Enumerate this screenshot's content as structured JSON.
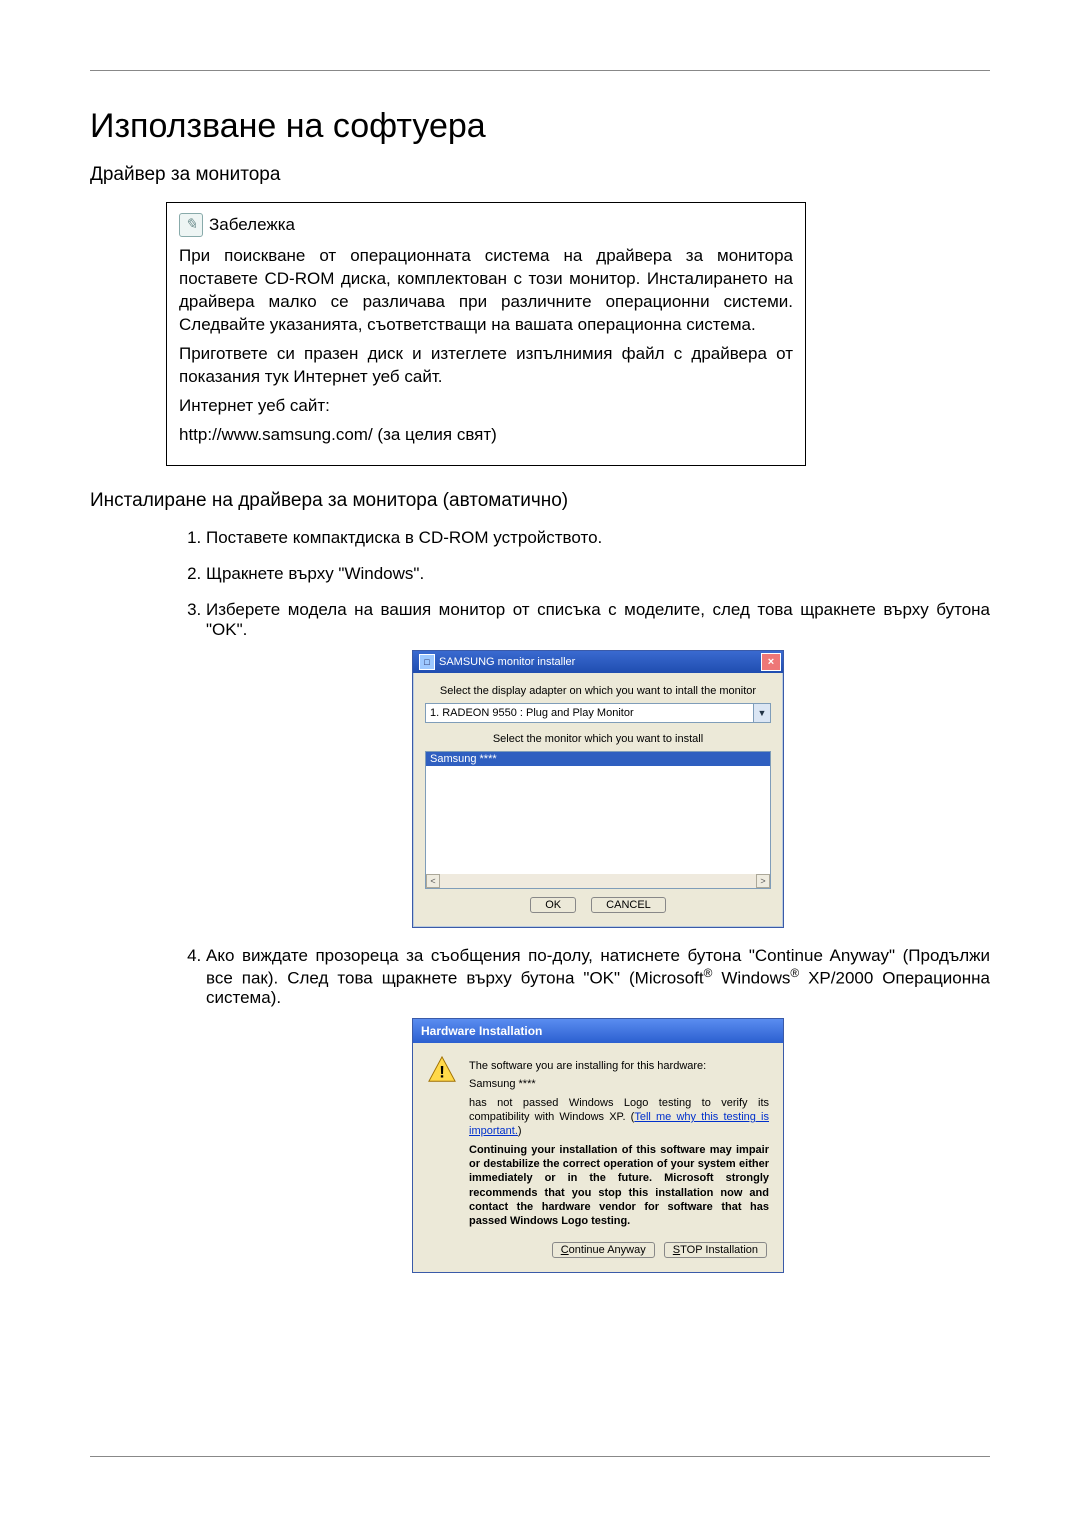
{
  "page": {
    "title": "Използване на софтуера",
    "section1": "Драйвер за монитора",
    "section2": "Инсталиране на драйвера за монитора (автоматично)"
  },
  "note": {
    "icon_glyph": "✎",
    "heading": "Забележка",
    "p1": "При поискване от операционната система на драйвера за монитора поставете CD-ROM диска, комплектован с този монитор. Инсталирането на драйвера малко се различава при различните операционни системи. Следвайте указанията, съответстващи на вашата операционна система.",
    "p2": "Пригответе си празен диск и изтеглете изпълнимия файл с драйвера от показания тук Интернет уеб сайт.",
    "site_label": "Интернет уеб сайт:",
    "site_value": "http://www.samsung.com/ (за целия свят)"
  },
  "steps": {
    "s1": "Поставете компактдиска в CD-ROM устройството.",
    "s2": "Щракнете върху \"Windows\".",
    "s3": "Изберете модела на вашия монитор от списъка с моделите, след това щракнете върху бутона \"OK\".",
    "s4_a": "Ако виждате прозореца за съобщения по-долу, натиснете бутона \"Continue Anyway\" (Продължи все пак). След това щракнете върху бутона \"OK\" (Microsoft",
    "s4_b": " Windows",
    "s4_c": " XP/2000 Операционна система).",
    "reg": "®"
  },
  "installer": {
    "title": "SAMSUNG monitor installer",
    "close": "×",
    "label_adapter": "Select the display adapter on which you want to intall the monitor",
    "combo_value": "1. RADEON 9550 : Plug and Play Monitor",
    "combo_arrow": "▼",
    "label_monitor": "Select the monitor which you want to install",
    "list_selected": "Samsung ****",
    "scroll_left": "<",
    "scroll_right": ">",
    "btn_ok": "OK",
    "btn_cancel": "CANCEL"
  },
  "hw": {
    "title": "Hardware Installation",
    "warn_glyph": "!",
    "line1": "The software you are installing for this hardware:",
    "line2": "Samsung ****",
    "line3a": "has not passed Windows Logo testing to verify its compatibility with Windows XP. (",
    "line3_link": "Tell me why this testing is important.",
    "line3b": ")",
    "bold": "Continuing your installation of this software may impair or destabilize the correct operation of your system either immediately or in the future. Microsoft strongly recommends that you stop this installation now and contact the hardware vendor for software that has passed Windows Logo testing.",
    "btn_continue": "Continue Anyway",
    "btn_stop": "STOP Installation"
  }
}
